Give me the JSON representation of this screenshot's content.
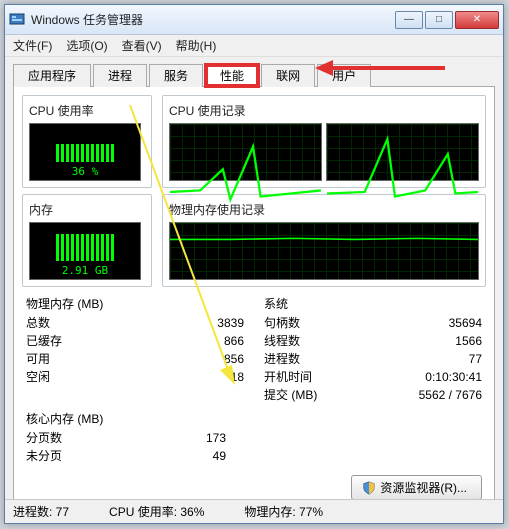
{
  "title": "Windows 任务管理器",
  "menu": {
    "file": "文件(F)",
    "options": "选项(O)",
    "view": "查看(V)",
    "help": "帮助(H)"
  },
  "tabs": {
    "apps": "应用程序",
    "procs": "进程",
    "services": "服务",
    "perf": "性能",
    "net": "联网",
    "users": "用户"
  },
  "groups": {
    "cpu_usage": "CPU 使用率",
    "cpu_history": "CPU 使用记录",
    "memory": "内存",
    "phys_history": "物理内存使用记录"
  },
  "cpu_pct": "36 %",
  "mem_val": "2.91 GB",
  "phys_mem_header": "物理内存 (MB)",
  "phys": {
    "total_l": "总数",
    "total_v": "3839",
    "cached_l": "已缓存",
    "cached_v": "866",
    "avail_l": "可用",
    "avail_v": "856",
    "free_l": "空闲",
    "free_v": "18"
  },
  "kernel_header": "核心内存 (MB)",
  "kernel": {
    "paged_l": "分页数",
    "paged_v": "173",
    "nonpaged_l": "未分页",
    "nonpaged_v": "49"
  },
  "sys_header": "系统",
  "sys": {
    "handles_l": "句柄数",
    "handles_v": "35694",
    "threads_l": "线程数",
    "threads_v": "1566",
    "procs_l": "进程数",
    "procs_v": "77",
    "uptime_l": "开机时间",
    "uptime_v": "0:10:30:41",
    "commit_l": "提交 (MB)",
    "commit_v": "5562 / 7676"
  },
  "res_monitor": "资源监视器(R)...",
  "status": {
    "procs": "进程数: 77",
    "cpu": "CPU 使用率: 36%",
    "phys": "物理内存: 77%"
  }
}
